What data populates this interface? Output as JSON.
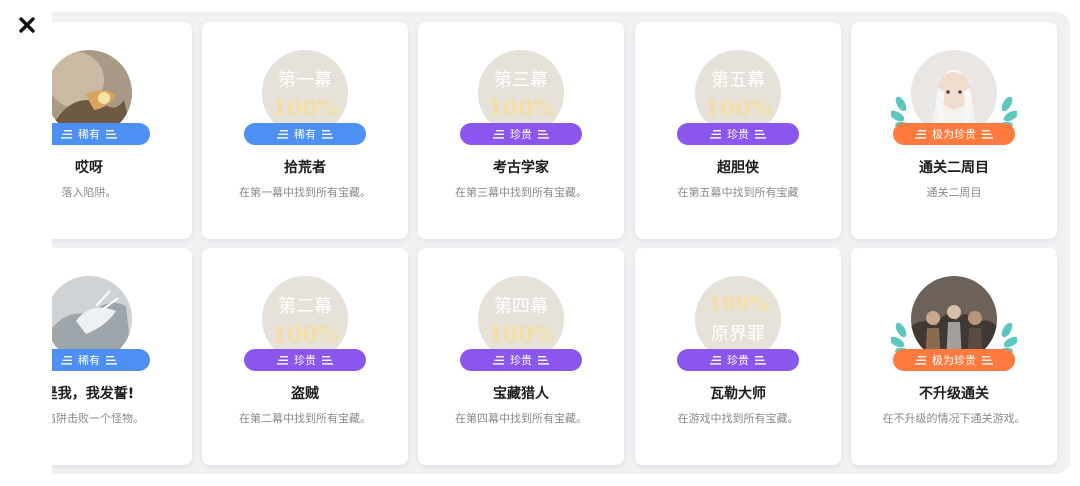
{
  "close_icon": "close-icon",
  "rarity_colors": {
    "rare": "#4d8ff2",
    "precious": "#8a56ee",
    "very_precious": "#ff7a3e"
  },
  "achievements": [
    {
      "title": "哎呀",
      "desc": "落入陷阱。",
      "rarity": "稀有",
      "image": "creature-image"
    },
    {
      "title": "拾荒者",
      "desc": "在第一幕中找到所有宝藏。",
      "rarity": "稀有",
      "image_line1": "第一幕",
      "image_line2": "100%"
    },
    {
      "title": "考古学家",
      "desc": "在第三幕中找到所有宝藏。",
      "rarity": "珍贵",
      "image_line1": "第三幕",
      "image_line2": "100%"
    },
    {
      "title": "超胆侠",
      "desc": "在第五幕中找到所有宝藏",
      "rarity": "珍贵",
      "image_line1": "第五幕",
      "image_line2": "100%"
    },
    {
      "title": "通关二周目",
      "desc": "通关二周目",
      "rarity": "极为珍贵",
      "image": "character-portrait"
    },
    {
      "title": "是我，我发誓!",
      "desc": "的陷阱击败一个怪物。",
      "rarity": "稀有",
      "image": "creature-image"
    },
    {
      "title": "盗贼",
      "desc": "在第二幕中找到所有宝藏。",
      "rarity": "珍贵",
      "image_line1": "第二幕",
      "image_line2": "100%"
    },
    {
      "title": "宝藏猎人",
      "desc": "在第四幕中找到所有宝藏。",
      "rarity": "珍贵",
      "image_line1": "第四幕",
      "image_line2": "100%"
    },
    {
      "title": "瓦勒大师",
      "desc": "在游戏中找到所有宝藏。",
      "rarity": "珍贵",
      "image_line1": "100%",
      "image_line2": "原界罪"
    },
    {
      "title": "不升级通关",
      "desc": "在不升级的情况下通关游戏。",
      "rarity": "极为珍贵",
      "image": "group-portrait"
    }
  ]
}
